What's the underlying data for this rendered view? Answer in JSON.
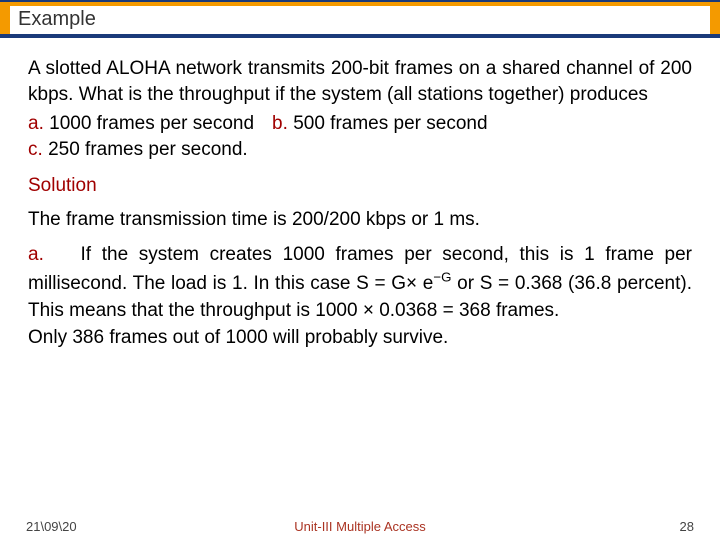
{
  "header": {
    "title": "Example"
  },
  "problem": {
    "text": "A slotted ALOHA  network transmits 200-bit frames on a shared channel of 200 kbps. What is the throughput if the system (all stations together) produces",
    "a_label": "a.",
    "a_text": "1000 frames per second",
    "b_label": "b.",
    "b_text": "500 frames per second",
    "c_label": "c.",
    "c_text": "250 frames per second."
  },
  "solution": {
    "heading": "Solution",
    "line1": "The frame transmission time is 200/200 kbps or 1 ms.",
    "a_label": "a.",
    "a_body_1": "If the system creates 1000 frames per second, this is 1 frame per millisecond. The load is 1. In this case S = G× e",
    "a_exp": "−G",
    "a_body_2": " or S = 0.368 (36.8 percent). This means that the throughput is 1000 × 0.0368 = 368 frames.",
    "a_tail": "Only 386 frames out of 1000 will probably survive."
  },
  "footer": {
    "left": "21\\09\\20",
    "center": "Unit-III Multiple Access",
    "right": "28"
  }
}
